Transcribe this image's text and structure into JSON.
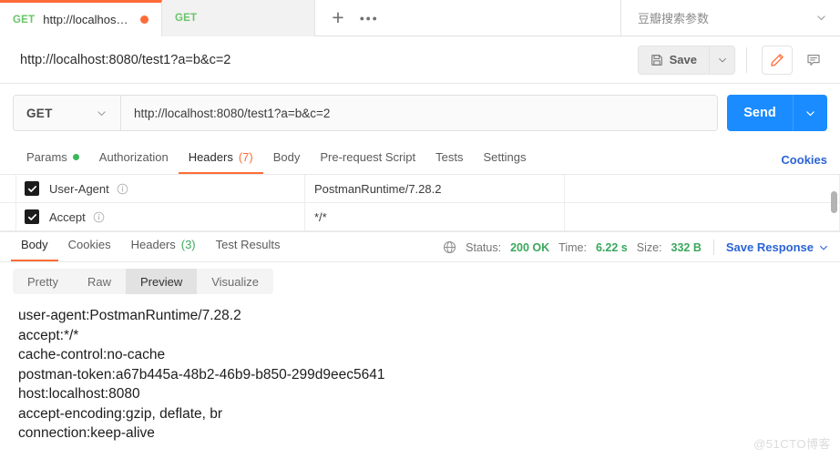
{
  "tabbar": {
    "tabs": [
      {
        "method": "GET",
        "title": "http://localhost:80...",
        "unsaved": true,
        "active": true
      },
      {
        "method": "GET",
        "title": "",
        "unsaved": false,
        "active": false
      }
    ],
    "new_tab_icon": "plus-icon",
    "more_icon": "more-horizontal-icon",
    "environment": "豆瓣搜索参数",
    "environment_caret_icon": "chevron-down-icon"
  },
  "namebar": {
    "request_name": "http://localhost:8080/test1?a=b&c=2",
    "save_label": "Save",
    "save_icon": "floppy-disk-icon",
    "save_caret_icon": "chevron-down-icon",
    "edit_icon": "pencil-icon",
    "comment_icon": "comment-icon"
  },
  "urlrow": {
    "method": "GET",
    "method_caret_icon": "chevron-down-icon",
    "url": "http://localhost:8080/test1?a=b&c=2",
    "send_label": "Send",
    "send_caret_icon": "chevron-down-icon",
    "send_color": "#1a8cff"
  },
  "request_tabs": {
    "items": [
      {
        "label": "Params",
        "dot": true,
        "count": "",
        "active": false
      },
      {
        "label": "Authorization",
        "dot": false,
        "count": "",
        "active": false
      },
      {
        "label": "Headers",
        "dot": false,
        "count": "(7)",
        "active": true
      },
      {
        "label": "Body",
        "dot": false,
        "count": "",
        "active": false
      },
      {
        "label": "Pre-request Script",
        "dot": false,
        "count": "",
        "active": false
      },
      {
        "label": "Tests",
        "dot": false,
        "count": "",
        "active": false
      },
      {
        "label": "Settings",
        "dot": false,
        "count": "",
        "active": false
      }
    ],
    "cookies_link": "Cookies",
    "accent_color": "#ff6c37"
  },
  "headers_table": {
    "rows": [
      {
        "checked": true,
        "key": "User-Agent",
        "info_icon": "info-icon",
        "value": "PostmanRuntime/7.28.2",
        "description": ""
      },
      {
        "checked": true,
        "key": "Accept",
        "info_icon": "info-icon",
        "value": "*/*",
        "description": ""
      }
    ]
  },
  "response": {
    "tabs": [
      {
        "label": "Body",
        "count": "",
        "active": true
      },
      {
        "label": "Cookies",
        "count": "",
        "active": false
      },
      {
        "label": "Headers",
        "count": "(3)",
        "active": false
      },
      {
        "label": "Test Results",
        "count": "",
        "active": false
      }
    ],
    "globe_icon": "globe-icon",
    "status_label": "Status:",
    "status_value": "200 OK",
    "time_label": "Time:",
    "time_value": "6.22 s",
    "size_label": "Size:",
    "size_value": "332 B",
    "save_response_label": "Save Response",
    "save_response_caret_icon": "chevron-down-icon",
    "ok_color": "#3aa75c",
    "link_color": "#2a64d4"
  },
  "view_modes": {
    "items": [
      {
        "label": "Pretty",
        "active": false
      },
      {
        "label": "Raw",
        "active": false
      },
      {
        "label": "Preview",
        "active": true
      },
      {
        "label": "Visualize",
        "active": false
      }
    ]
  },
  "body_preview": {
    "lines": [
      "user-agent:PostmanRuntime/7.28.2",
      "accept:*/*",
      "cache-control:no-cache",
      "postman-token:a67b445a-48b2-46b9-b850-299d9eec5641",
      "host:localhost:8080",
      "accept-encoding:gzip, deflate, br",
      "connection:keep-alive"
    ]
  },
  "watermark": "@51CTO博客"
}
